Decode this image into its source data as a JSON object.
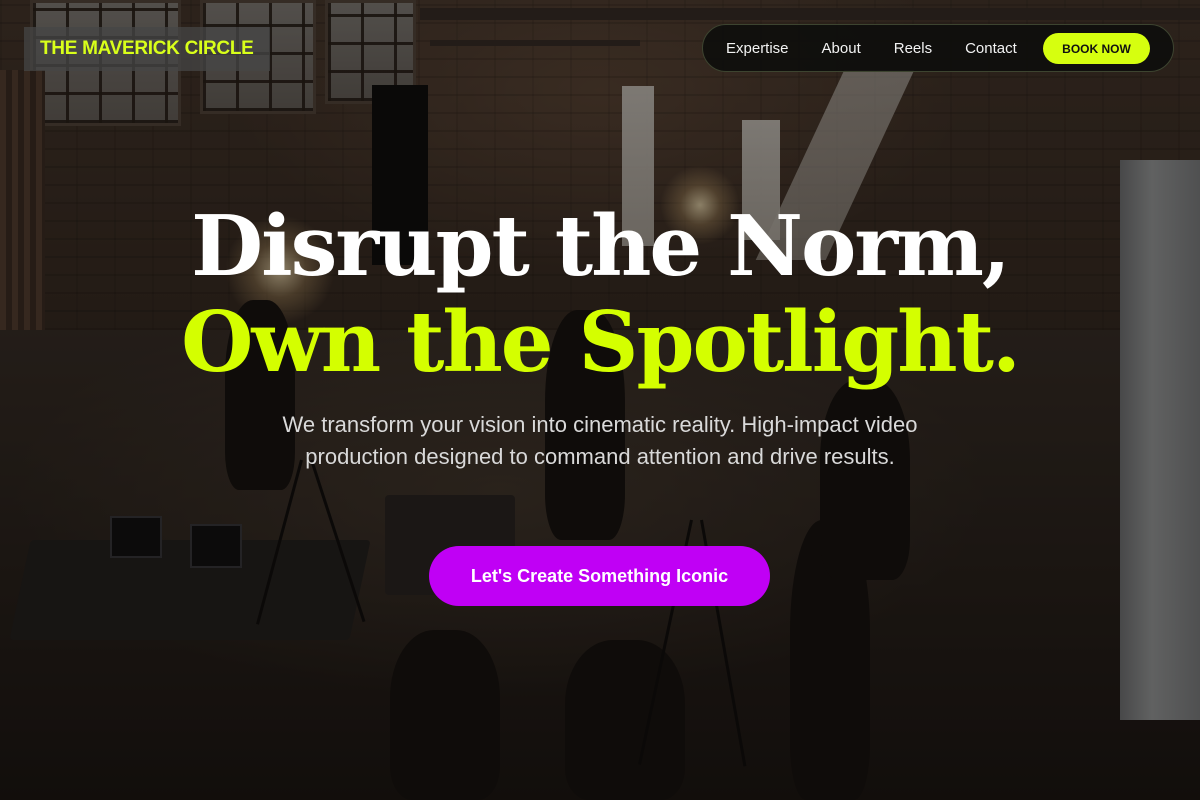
{
  "header": {
    "logo_text": "THE MAVERICK CIRCLE",
    "nav_items": [
      {
        "label": "Expertise"
      },
      {
        "label": "About"
      },
      {
        "label": "Reels"
      },
      {
        "label": "Contact"
      }
    ],
    "book_label": "BOOK NOW"
  },
  "hero": {
    "headline_line1": "Disrupt the Norm,",
    "headline_line2": "Own the Spotlight.",
    "subheadline": "We transform your vision into cinematic reality. High-impact video production designed to command attention and drive results.",
    "cta_label": "Let's Create Something Iconic"
  },
  "colors": {
    "accent_lime": "#d4ff00",
    "cta_purple": "#c000f5",
    "nav_background": "#0e0e0c"
  }
}
